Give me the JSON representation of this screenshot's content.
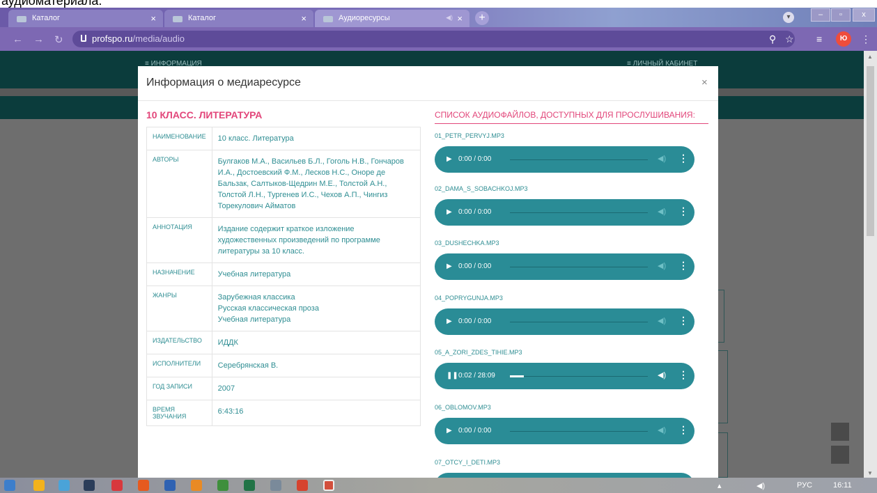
{
  "caption": "аудиоматериала.",
  "browser": {
    "tabs": [
      {
        "label": "Каталог"
      },
      {
        "label": "Каталог"
      },
      {
        "label": "Аудиоресурсы"
      }
    ],
    "url_host": "profspo.ru",
    "url_path": "/media/audio",
    "profile": "Ю"
  },
  "site": {
    "nav_left": "≡  ИНФОРМАЦИЯ",
    "nav_right": "≡  ЛИЧНЫЙ КАБИНЕТ"
  },
  "modal": {
    "title": "Информация о медиаресурсе",
    "close": "×",
    "resource_title": "10 КЛАСС. ЛИТЕРАТУРА",
    "rows": [
      {
        "key": "НАИМЕНОВАНИЕ",
        "value": "10 класс. Литература"
      },
      {
        "key": "АВТОРЫ",
        "value": "Булгаков М.А., Васильев Б.Л., Гоголь Н.В., Гончаров И.А., Достоевский Ф.М., Лесков Н.С., Оноре де Бальзак, Салтыков-Щедрин М.Е., Толстой А.Н., Толстой Л.Н., Тургенев И.С., Чехов А.П., Чингиз Торекулович Айматов"
      },
      {
        "key": "АННОТАЦИЯ",
        "value": "Издание содержит краткое изложение художественных произведений по программе литературы за 10 класс."
      },
      {
        "key": "НАЗНАЧЕНИЕ",
        "value": "Учебная литература"
      },
      {
        "key": "ЖАНРЫ",
        "value": "Зарубежная классика\nРусская классическая проза\nУчебная литература"
      },
      {
        "key": "ИЗДАТЕЛЬСТВО",
        "value": "ИДДК"
      },
      {
        "key": "ИСПОЛНИТЕЛИ",
        "value": "Серебрянская В."
      },
      {
        "key": "ГОД ЗАПИСИ",
        "value": "2007"
      },
      {
        "key": "ВРЕМЯ ЗВУЧАНИЯ",
        "value": "6:43:16"
      }
    ],
    "list_title": "Список аудиофайлов, доступных для прослушивания:",
    "tracks": [
      {
        "name": "01_PETR_PERVYJ.MP3",
        "time": "0:00 / 0:00",
        "playing": false,
        "progress": 0
      },
      {
        "name": "02_DAMA_S_SOBACHKOJ.MP3",
        "time": "0:00 / 0:00",
        "playing": false,
        "progress": 0
      },
      {
        "name": "03_DUSHECHKA.MP3",
        "time": "0:00 / 0:00",
        "playing": false,
        "progress": 0
      },
      {
        "name": "04_POPRYGUNJA.MP3",
        "time": "0:00 / 0:00",
        "playing": false,
        "progress": 0
      },
      {
        "name": "05_A_ZORI_ZDES_TIHIE.MP3",
        "time": "0:02 / 28:09",
        "playing": true,
        "progress": 0.1
      },
      {
        "name": "06_OBLOMOV.MP3",
        "time": "0:00 / 0:00",
        "playing": false,
        "progress": 0
      },
      {
        "name": "07_OTCY_I_DETI.MP3",
        "time": "",
        "playing": false,
        "progress": 0
      }
    ]
  },
  "taskbar": {
    "lang": "РУС",
    "clock": "16:11"
  }
}
